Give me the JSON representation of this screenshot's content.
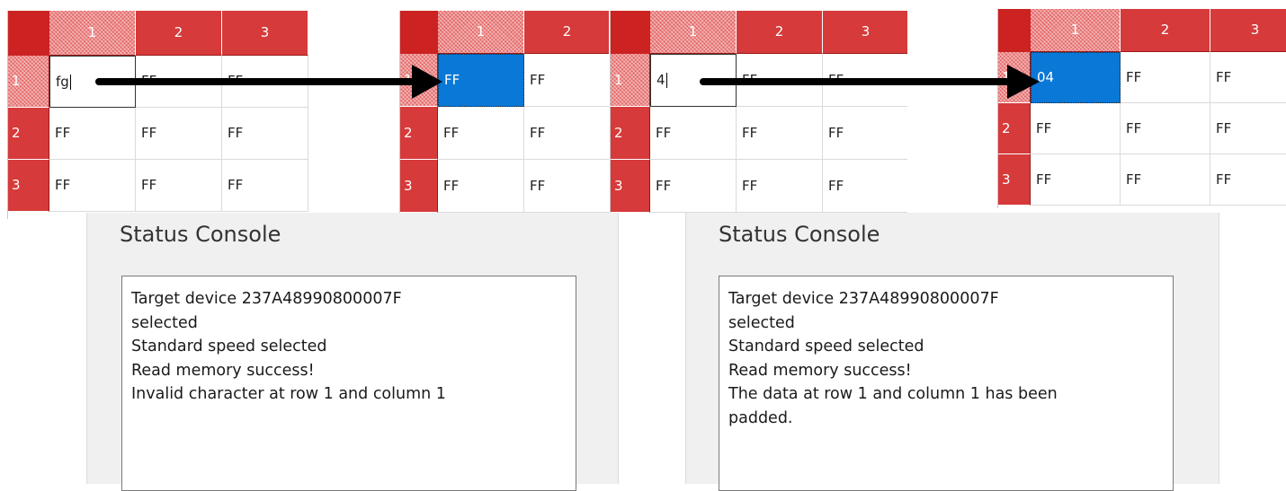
{
  "colors": {
    "header_red": "#d63a3a",
    "corner_red": "#cc2222",
    "selection_blue": "#0a78d7",
    "panel_bg": "#f0f0f0"
  },
  "grids": [
    {
      "columns": [
        "1",
        "2",
        "3"
      ],
      "rows": [
        {
          "label": "1",
          "cells": [
            "fg",
            "FF",
            "FF"
          ]
        },
        {
          "label": "2",
          "cells": [
            "FF",
            "FF",
            "FF"
          ]
        },
        {
          "label": "3",
          "cells": [
            "FF",
            "FF",
            "FF"
          ]
        }
      ],
      "state": "editing"
    },
    {
      "columns": [
        "1",
        "2"
      ],
      "rows": [
        {
          "label": "1",
          "cells": [
            "FF",
            "FF"
          ]
        },
        {
          "label": "2",
          "cells": [
            "FF",
            "FF"
          ]
        },
        {
          "label": "3",
          "cells": [
            "FF",
            "FF"
          ]
        }
      ],
      "state": "selected"
    },
    {
      "columns": [
        "1",
        "2",
        "3"
      ],
      "rows": [
        {
          "label": "1",
          "cells": [
            "4",
            "FF",
            "FF"
          ]
        },
        {
          "label": "2",
          "cells": [
            "FF",
            "FF",
            "FF"
          ]
        },
        {
          "label": "3",
          "cells": [
            "FF",
            "FF",
            "FF"
          ]
        }
      ],
      "state": "editing"
    },
    {
      "columns": [
        "1",
        "2",
        "3"
      ],
      "rows": [
        {
          "label": "1",
          "cells": [
            "04",
            "FF",
            "FF"
          ]
        },
        {
          "label": "2",
          "cells": [
            "FF",
            "FF",
            "FF"
          ]
        },
        {
          "label": "3",
          "cells": [
            "FF",
            "FF",
            "FF"
          ]
        }
      ],
      "state": "selected"
    }
  ],
  "consoles": [
    {
      "title": "Status Console",
      "lines": [
        "Target device 237A48990800007F",
        "selected",
        "Standard speed selected",
        "Read memory success!",
        "Invalid character at row 1 and column 1"
      ]
    },
    {
      "title": "Status Console",
      "lines": [
        "Target device 237A48990800007F",
        "selected",
        "Standard speed selected",
        "Read memory success!",
        "The data at row 1 and column 1 has been",
        "padded."
      ]
    }
  ]
}
